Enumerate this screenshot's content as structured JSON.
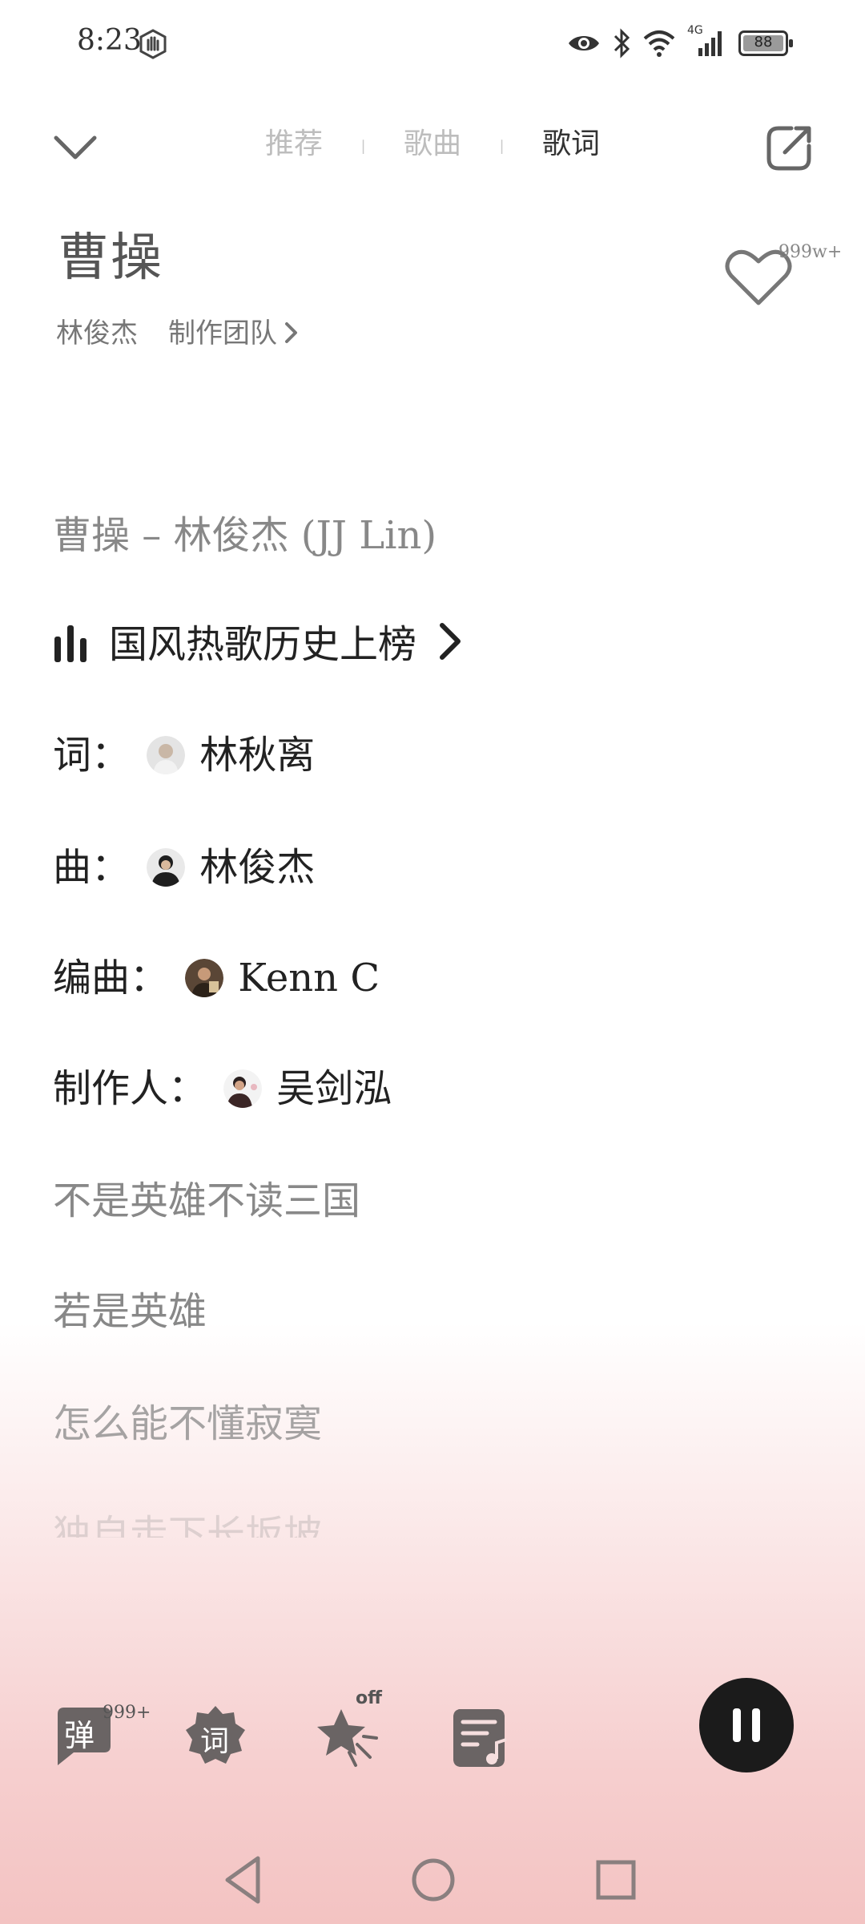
{
  "status_bar": {
    "time": "8:23",
    "network": "4G",
    "battery": "88"
  },
  "nav": {
    "tabs": [
      {
        "label": "推荐",
        "active": false
      },
      {
        "label": "歌曲",
        "active": false
      },
      {
        "label": "歌词",
        "active": true
      }
    ]
  },
  "song": {
    "title": "曹操",
    "artist": "林俊杰",
    "team_link": "制作团队",
    "like_count": "999w+"
  },
  "lyrics": {
    "header": "曹操 – 林俊杰 (JJ Lin)",
    "chart_name": "国风热歌历史上榜",
    "credits": [
      {
        "role": "词：",
        "name": "林秋离"
      },
      {
        "role": "曲：",
        "name": "林俊杰"
      },
      {
        "role": "编曲：",
        "name": "Kenn C"
      },
      {
        "role": "制作人：",
        "name": "吴剑泓"
      }
    ],
    "lines": [
      "不是英雄不读三国",
      "若是英雄",
      "怎么能不懂寂寞",
      "独自走下长坂坡"
    ]
  },
  "controls": {
    "danmu_label": "弹",
    "danmu_count": "999+",
    "lyric_label": "词",
    "star_status": "off"
  },
  "colors": {
    "accent_dark": "#1b1b1b",
    "background_bottom": "#f3c3c2"
  }
}
